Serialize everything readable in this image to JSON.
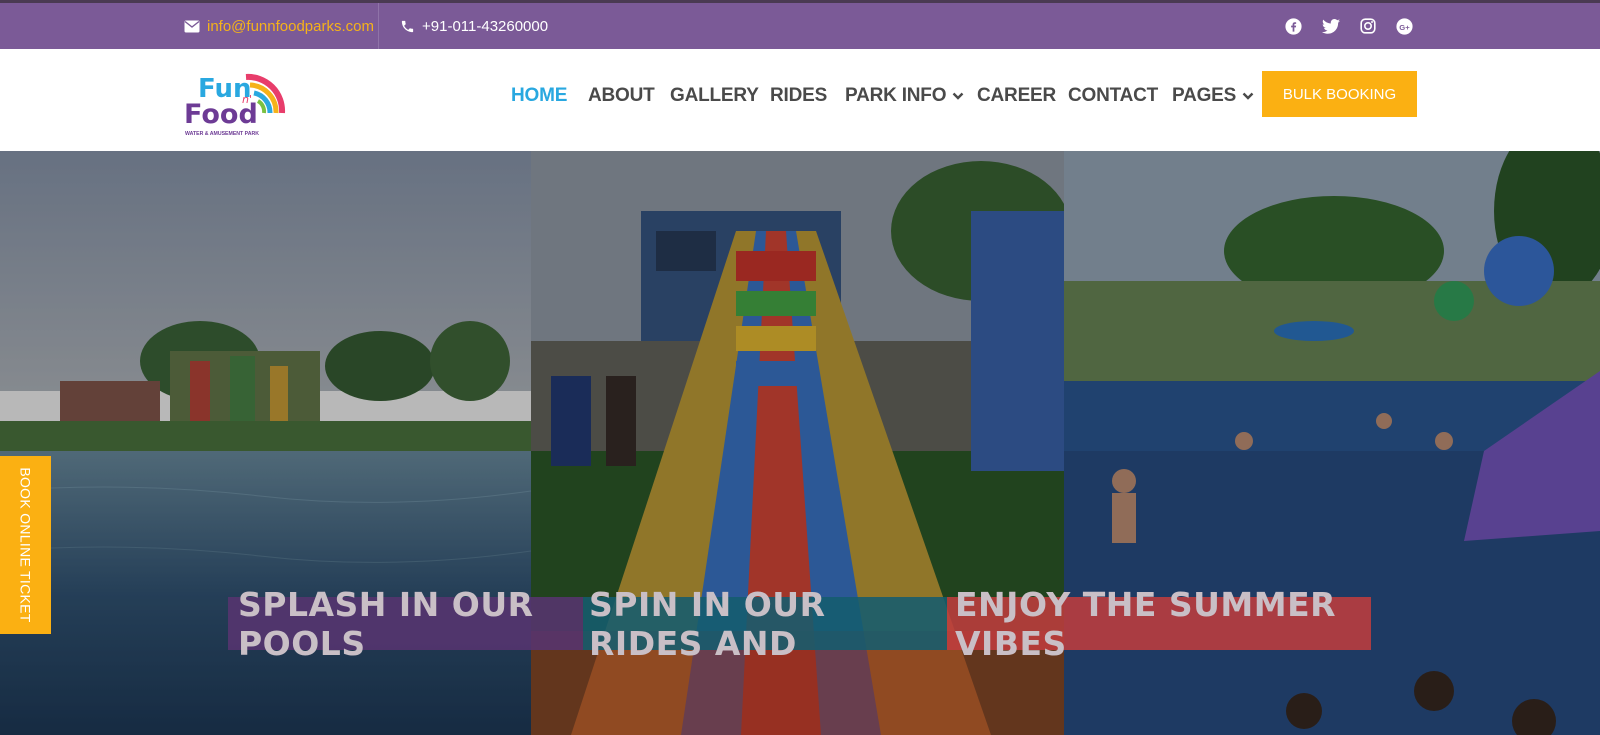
{
  "topbar": {
    "email": "info@funnfoodparks.com",
    "phone": "+91-011-43260000",
    "social_icons": [
      "facebook-icon",
      "twitter-icon",
      "instagram-icon",
      "google-plus-icon"
    ]
  },
  "header": {
    "logo_text_1": "Fun",
    "logo_text_2": "Food",
    "logo_text_3": "n'",
    "logo_subtitle": "WATER & AMUSEMENT PARK",
    "nav": [
      {
        "label": "HOME"
      },
      {
        "label": "ABOUT"
      },
      {
        "label": "GALLERY"
      },
      {
        "label": "RIDES"
      },
      {
        "label": "PARK INFO"
      },
      {
        "label": "CAREER"
      },
      {
        "label": "CONTACT"
      },
      {
        "label": "PAGES"
      }
    ],
    "bulk_booking": "BULK BOOKING"
  },
  "hero": {
    "book_tab": "BOOK ONLINE TICKET",
    "tagline_1": "SPLASH IN OUR POOLS",
    "tagline_2": "SPIN IN OUR RIDES AND",
    "tagline_3": "ENJOY THE SUMMER VIBES"
  },
  "colors": {
    "topbar": "#7b5a97",
    "accent": "#fbb012",
    "nav_active": "#29a8e0",
    "nav_text": "#4a4a4a"
  }
}
